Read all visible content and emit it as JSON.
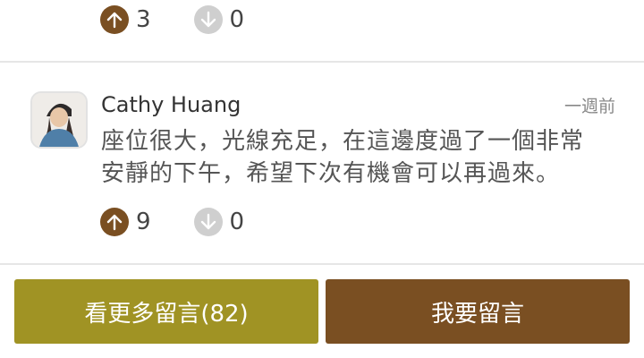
{
  "prev_comment": {
    "upvotes": "3",
    "downvotes": "0"
  },
  "comment": {
    "author": "Cathy Huang",
    "time": "一週前",
    "text_line1": "座位很大，光線充足，在這邊度過了一個非常",
    "text_line2": "安靜的下午，希望下次有機會可以再過來。",
    "upvotes": "9",
    "downvotes": "0"
  },
  "buttons": {
    "more_label": "看更多留言(82)",
    "leave_label": "我要留言"
  },
  "colors": {
    "upvote": "#7a4f22",
    "downvote": "#cfcfcf",
    "more_button": "#a09324",
    "leave_button": "#7a4f22"
  },
  "icons": {
    "upvote": "arrow-up-icon",
    "downvote": "arrow-down-icon"
  }
}
